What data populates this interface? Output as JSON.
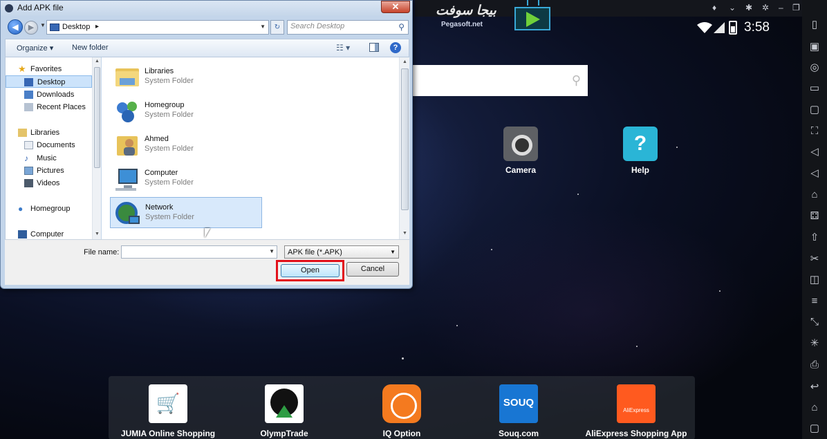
{
  "dialog": {
    "title": "Add APK file",
    "close_label": "✕",
    "address": {
      "location": "Desktop",
      "separator": "▸"
    },
    "search": {
      "placeholder": "Search Desktop"
    },
    "toolbar": {
      "organize": "Organize ▾",
      "new_folder": "New folder"
    },
    "nav_items": [
      {
        "label": "Favorites",
        "icon": "star-icon",
        "selected": false
      },
      {
        "label": "Desktop",
        "icon": "desktop-icon",
        "selected": true
      },
      {
        "label": "Downloads",
        "icon": "downloads-icon",
        "selected": false
      },
      {
        "label": "Recent Places",
        "icon": "recent-places-icon",
        "selected": false
      },
      {
        "label": "Libraries",
        "icon": "libraries-icon",
        "selected": false
      },
      {
        "label": "Documents",
        "icon": "documents-icon",
        "selected": false
      },
      {
        "label": "Music",
        "icon": "music-icon",
        "selected": false
      },
      {
        "label": "Pictures",
        "icon": "pictures-icon",
        "selected": false
      },
      {
        "label": "Videos",
        "icon": "videos-icon",
        "selected": false
      },
      {
        "label": "Homegroup",
        "icon": "homegroup-icon",
        "selected": false
      },
      {
        "label": "Computer",
        "icon": "computer-icon",
        "selected": false
      }
    ],
    "files": [
      {
        "name": "Libraries",
        "type": "System Folder",
        "icon": "libraries-folder-icon",
        "selected": false
      },
      {
        "name": "Homegroup",
        "type": "System Folder",
        "icon": "homegroup-icon",
        "selected": false
      },
      {
        "name": "Ahmed",
        "type": "System Folder",
        "icon": "user-folder-icon",
        "selected": false
      },
      {
        "name": "Computer",
        "type": "System Folder",
        "icon": "computer-icon",
        "selected": false
      },
      {
        "name": "Network",
        "type": "System Folder",
        "icon": "network-icon",
        "selected": true
      }
    ],
    "file_name": {
      "label": "File name:",
      "value": ""
    },
    "file_type": "APK file (*.APK)",
    "open_label": "Open",
    "cancel_label": "Cancel"
  },
  "emulator": {
    "logo": {
      "arabic": "بيجا سوفت",
      "domain": "Pegasoft.net"
    },
    "status": {
      "time": "3:58"
    },
    "search_icon": "magnifier-icon",
    "apps": [
      {
        "label": "Camera",
        "icon": "camera-icon"
      },
      {
        "label": "Help",
        "icon": "help-icon"
      }
    ],
    "dock": [
      {
        "label": "JUMIA Online Shopping",
        "icon": "jumia-cart-icon"
      },
      {
        "label": "OlympTrade",
        "icon": "olymptrade-icon"
      },
      {
        "label": "IQ Option",
        "icon": "iq-option-icon"
      },
      {
        "label": "Souq.com",
        "icon": "souq-icon",
        "tile_text": "SOUQ"
      },
      {
        "label": "AliExpress Shopping App",
        "icon": "aliexpress-icon",
        "tile_text": "AliExpress"
      }
    ],
    "colors": {
      "selection_highlight": "#e2101a",
      "souq_blue": "#1876d3",
      "aliexpress_orange": "#ff5a1f",
      "iq_orange": "#f47a1f"
    }
  }
}
